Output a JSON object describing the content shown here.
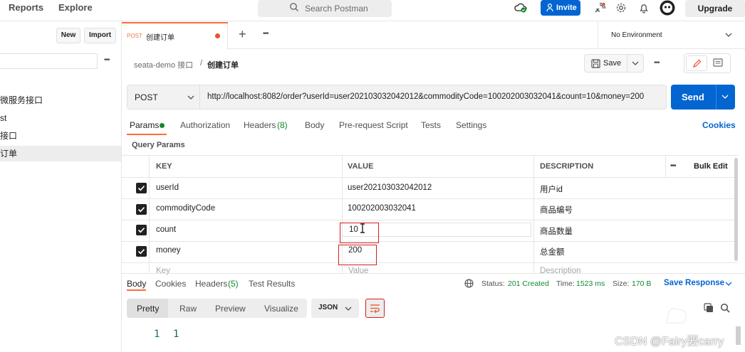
{
  "topbar": {
    "nav": [
      "Reports",
      "Explore"
    ],
    "search_placeholder": "Search Postman",
    "invite_label": "Invite",
    "upgrade_label": "Upgrade"
  },
  "sidebar": {
    "new_label": "New",
    "import_label": "Import",
    "more": "•••",
    "items": [
      {
        "label": "微服务接口"
      },
      {
        "label": "st"
      },
      {
        "label": "接口"
      },
      {
        "label": "订单"
      }
    ]
  },
  "tabs": {
    "active": {
      "method": "POST",
      "name": "创建订单"
    },
    "new_tab": "+",
    "more": "•••",
    "environment": "No Environment"
  },
  "breadcrumb": {
    "parent": "seata-demo 接口",
    "separator": "/",
    "current": "创建订单",
    "save_label": "Save",
    "more": "•••"
  },
  "request": {
    "method": "POST",
    "url": "http://localhost:8082/order?userId=user202103032042012&commodityCode=100202003032041&count=10&money=200",
    "send_label": "Send"
  },
  "request_tabs": [
    {
      "label": "Params"
    },
    {
      "label": "Authorization"
    },
    {
      "label": "Headers",
      "count": "(8)"
    },
    {
      "label": "Body"
    },
    {
      "label": "Pre-request Script"
    },
    {
      "label": "Tests"
    },
    {
      "label": "Settings"
    }
  ],
  "cookies_link": "Cookies",
  "query_params_title": "Query Params",
  "params_table": {
    "headers": {
      "key": "KEY",
      "value": "VALUE",
      "description": "DESCRIPTION",
      "more": "•••",
      "bulk_edit": "Bulk Edit"
    },
    "rows": [
      {
        "key": "userId",
        "value": "user202103032042012",
        "description": "用户id"
      },
      {
        "key": "commodityCode",
        "value": "100202003032041",
        "description": "商品编号"
      },
      {
        "key": "count",
        "value": "10",
        "description": "商品数量"
      },
      {
        "key": "money",
        "value": "200",
        "description": "总金额"
      }
    ],
    "placeholder": {
      "key": "Key",
      "value": "Value",
      "description": "Description"
    }
  },
  "response": {
    "tabs": [
      {
        "label": "Body"
      },
      {
        "label": "Cookies"
      },
      {
        "label": "Headers",
        "count": "(5)"
      },
      {
        "label": "Test Results"
      }
    ],
    "status_label": "Status:",
    "status_value": "201 Created",
    "time_label": "Time:",
    "time_value": "1523 ms",
    "size_label": "Size:",
    "size_value": "170 B",
    "save_response": "Save Response",
    "formats": [
      "Pretty",
      "Raw",
      "Preview",
      "Visualize"
    ],
    "language": "JSON",
    "code_line_number": "1",
    "code_value": "1"
  },
  "watermark": "CSDN @Fairy要carry",
  "colors": {
    "accent_orange": "#ff6c37",
    "primary_blue": "#0265d2",
    "annotation_red": "#d81e1e",
    "status_green": "#0f8a2e"
  }
}
